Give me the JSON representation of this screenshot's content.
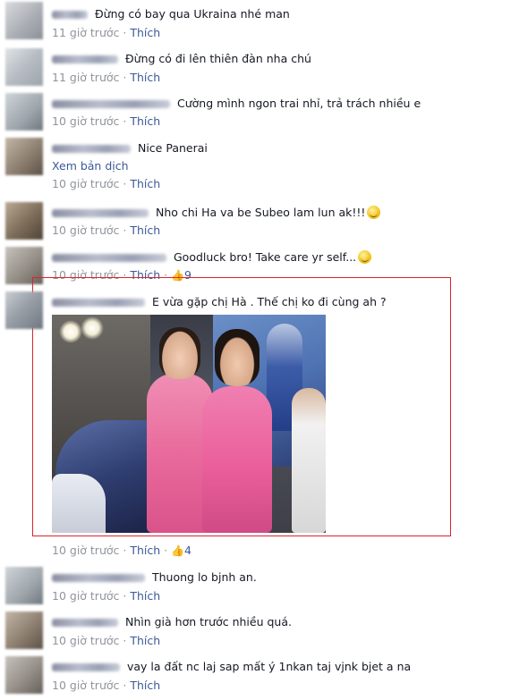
{
  "comments": [
    {
      "text": "Đừng có bay qua Ukraina nhé man",
      "time": "11 giờ trước",
      "like": "Thích"
    },
    {
      "text": "Đừng có đi lên thiên đàn nha chú",
      "time": "11 giờ trước",
      "like": "Thích"
    },
    {
      "text": "Cường mình ngon trai nhỉ, trả trách nhiều e",
      "time": "10 giờ trước",
      "like": "Thích"
    },
    {
      "text": "Nice Panerai",
      "translate": "Xem bản dịch",
      "time": "10 giờ trước",
      "like": "Thích"
    },
    {
      "text": "Nho chi Ha va be Subeo lam lun ak!!!",
      "time": "10 giờ trước",
      "like": "Thích"
    },
    {
      "text": "Goodluck bro! Take care yr self...",
      "time": "10 giờ trước",
      "like": "Thích",
      "likes": "9"
    },
    {
      "text": "E vừa gặp chị Hà . Thế chị ko đi cùng ah ?",
      "time": "10 giờ trước",
      "like": "Thích",
      "likes": "4"
    },
    {
      "text": "Thuong lo bjnh an.",
      "time": "10 giờ trước",
      "like": "Thích"
    },
    {
      "text": "Nhìn già hơn trước nhiều quá.",
      "time": "10 giờ trước",
      "like": "Thích"
    },
    {
      "text": "vay la đất nc laj sap mất ý 1nkan taj vjnk bjet a na",
      "time": "10 giờ trước",
      "like": "Thích"
    }
  ],
  "icons": {
    "like": "thumbs-up-icon",
    "emoji": "smiley-icon"
  },
  "colors": {
    "link": "#3b5998",
    "meta": "#90949c",
    "highlight": "#d9232d"
  }
}
